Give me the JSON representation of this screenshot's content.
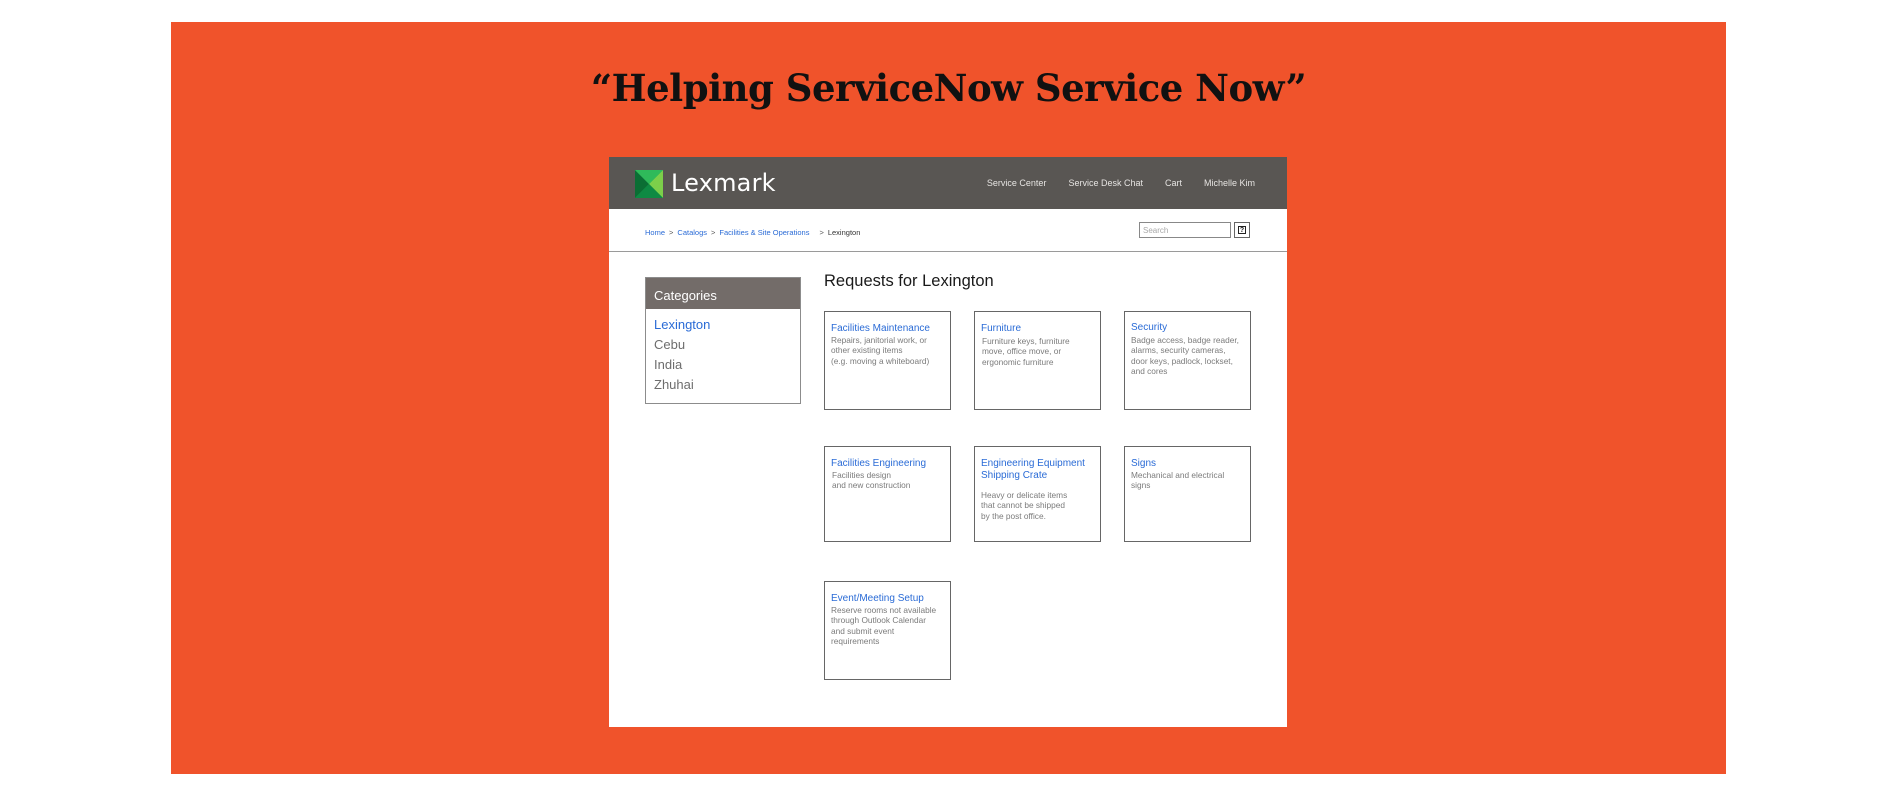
{
  "slide": {
    "background_color": "#f0532b",
    "title": "“Helping ServiceNow Service Now”"
  },
  "app": {
    "logo_text": "Lexmark",
    "logo_icon": "lexmark-logo-icon",
    "brand_colors": {
      "topbar": "#595653",
      "link": "#2a6bd6",
      "category_header": "#736c69"
    },
    "nav": [
      "Service Center",
      "Service Desk Chat",
      "Cart",
      "Michelle Kim"
    ]
  },
  "breadcrumb": {
    "home": "Home",
    "catalogs": "Catalogs",
    "facilities": "Facilities & Site Operations",
    "current": "Lexington",
    "separator": ">"
  },
  "search": {
    "placeholder": "Search",
    "button_icon": "help-icon",
    "button_glyph": "?"
  },
  "categories": {
    "header": "Categories",
    "items": [
      "Lexington",
      "Cebu",
      "India",
      "Zhuhai"
    ],
    "active": "Lexington"
  },
  "requests": {
    "title": "Requests for Lexington",
    "cards": [
      {
        "title": [
          "Facilities Maintenance"
        ],
        "desc": [
          "Repairs, janitorial work, or",
          "other existing items",
          "(e.g. moving a whiteboard)"
        ]
      },
      {
        "title": [
          "Furniture"
        ],
        "desc": [
          "Furniture keys, furniture",
          "move, office move, or",
          "ergonomic furniture"
        ]
      },
      {
        "title": [
          "Security"
        ],
        "desc": [
          "Badge access, badge reader,",
          "alarms, security cameras,",
          "door keys, padlock, lockset,",
          "and cores"
        ]
      },
      {
        "title": [
          "Facilities Engineering"
        ],
        "desc": [
          "Facilities design",
          "and new construction"
        ]
      },
      {
        "title": [
          "Engineering Equipment",
          "Shipping Crate"
        ],
        "desc": [
          "Heavy or delicate items",
          "that cannot be shipped",
          "by the post office."
        ]
      },
      {
        "title": [
          "Signs"
        ],
        "desc": [
          "Mechanical and electrical",
          "signs"
        ]
      },
      {
        "title": [
          "Event/Meeting Setup"
        ],
        "desc": [
          "Reserve rooms not available",
          "through Outlook Calendar",
          "and submit event",
          "requirements"
        ]
      }
    ]
  }
}
